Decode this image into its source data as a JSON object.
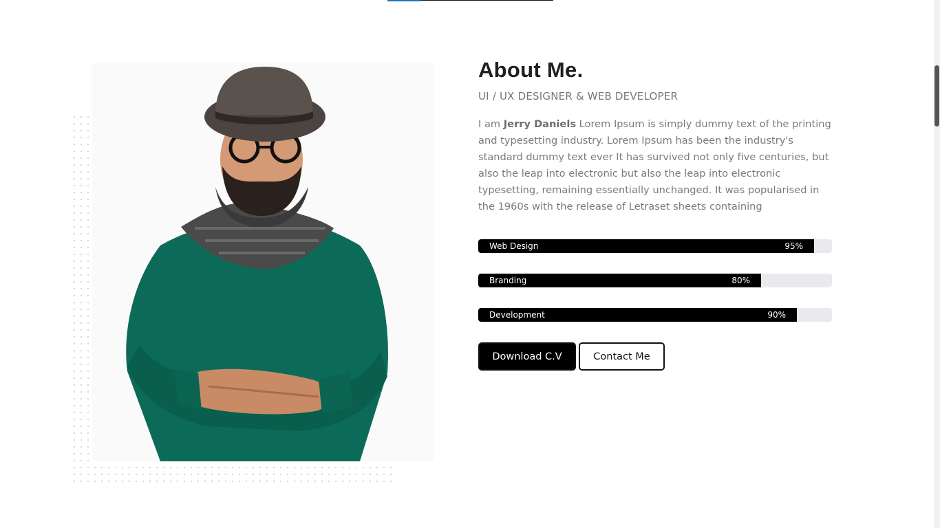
{
  "about": {
    "title": "About Me.",
    "subtitle": "UI / UX DESIGNER & WEB DEVELOPER",
    "bio_prefix": "I am ",
    "bio_name": "Jerry Daniels",
    "bio_text": " Lorem Ipsum is simply dummy text of the printing and typesetting industry. Lorem Ipsum has been the industry's standard dummy text ever It has survived not only five centuries, but also the leap into electronic but also the leap into electronic typesetting, remaining essentially unchanged. It was popularised in the 1960s with the release of Letraset sheets containing"
  },
  "skills": [
    {
      "name": "Web Design",
      "percent_label": "95%",
      "value": 95
    },
    {
      "name": "Branding",
      "percent_label": "80%",
      "value": 80
    },
    {
      "name": "Development",
      "percent_label": "90%",
      "value": 90
    }
  ],
  "buttons": {
    "download": "Download C.V",
    "contact": "Contact Me"
  },
  "colors": {
    "accent": "#1e73be",
    "bar_fill": "#000000",
    "bar_track": "#e8eaed",
    "sweater": "#0c6b58"
  },
  "icons": {
    "portrait": "man-with-hat-glasses-scarf"
  }
}
